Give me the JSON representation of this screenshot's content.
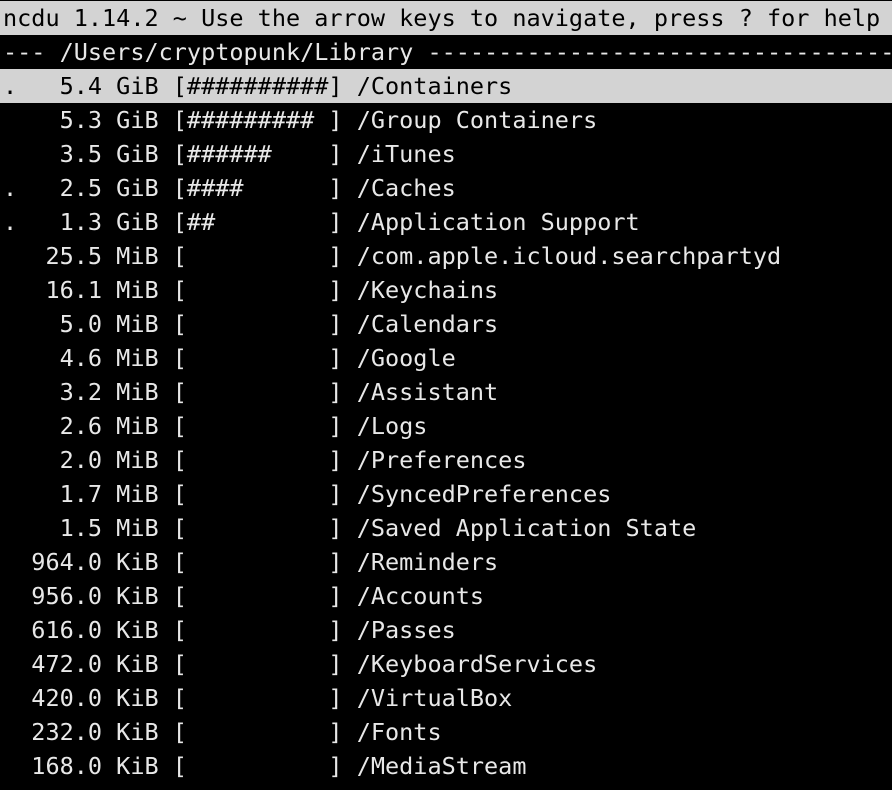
{
  "header": {
    "text": "ncdu 1.14.2 ~ Use the arrow keys to navigate, press ? for help"
  },
  "path_line": {
    "text": "--- /Users/cryptopunk/Library ---------------------------------------------"
  },
  "rows": [
    {
      "text": ".   5.4 GiB [##########] /Containers",
      "selected": true
    },
    {
      "text": "    5.3 GiB [######### ] /Group Containers",
      "selected": false
    },
    {
      "text": "    3.5 GiB [######    ] /iTunes",
      "selected": false
    },
    {
      "text": ".   2.5 GiB [####      ] /Caches",
      "selected": false
    },
    {
      "text": ".   1.3 GiB [##        ] /Application Support",
      "selected": false
    },
    {
      "text": "   25.5 MiB [          ] /com.apple.icloud.searchpartyd",
      "selected": false
    },
    {
      "text": "   16.1 MiB [          ] /Keychains",
      "selected": false
    },
    {
      "text": "    5.0 MiB [          ] /Calendars",
      "selected": false
    },
    {
      "text": "    4.6 MiB [          ] /Google",
      "selected": false
    },
    {
      "text": "    3.2 MiB [          ] /Assistant",
      "selected": false
    },
    {
      "text": "    2.6 MiB [          ] /Logs",
      "selected": false
    },
    {
      "text": "    2.0 MiB [          ] /Preferences",
      "selected": false
    },
    {
      "text": "    1.7 MiB [          ] /SyncedPreferences",
      "selected": false
    },
    {
      "text": "    1.5 MiB [          ] /Saved Application State",
      "selected": false
    },
    {
      "text": "  964.0 KiB [          ] /Reminders",
      "selected": false
    },
    {
      "text": "  956.0 KiB [          ] /Accounts",
      "selected": false
    },
    {
      "text": "  616.0 KiB [          ] /Passes",
      "selected": false
    },
    {
      "text": "  472.0 KiB [          ] /KeyboardServices",
      "selected": false
    },
    {
      "text": "  420.0 KiB [          ] /VirtualBox",
      "selected": false
    },
    {
      "text": "  232.0 KiB [          ] /Fonts",
      "selected": false
    },
    {
      "text": "  168.0 KiB [          ] /MediaStream",
      "selected": false
    }
  ],
  "colors": {
    "background": "#000000",
    "foreground": "#e8e8e8",
    "highlight": "#d3d3d3"
  }
}
